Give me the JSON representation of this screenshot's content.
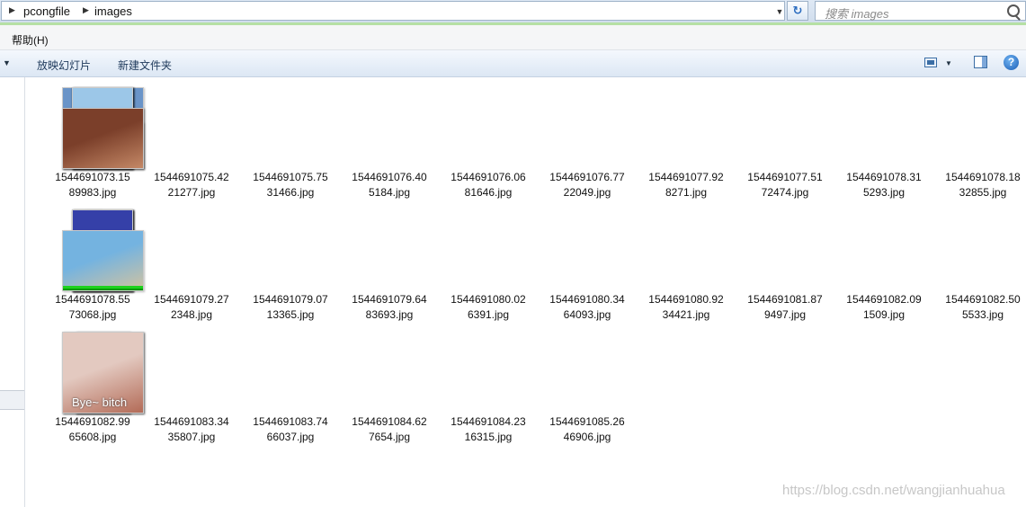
{
  "address_bar": {
    "crumbs": [
      "pcongfile",
      "images"
    ]
  },
  "search": {
    "placeholder": "搜索 images"
  },
  "menu": {
    "help": "帮助(H)"
  },
  "toolbar": {
    "slideshow": "放映幻灯片",
    "new_folder": "新建文件夹"
  },
  "files": [
    {
      "line1": "1544691073.15",
      "line2": "89983.jpg",
      "colors": [
        "#6a94c8",
        "#d6b89a"
      ]
    },
    {
      "line1": "1544691075.42",
      "line2": "21277.jpg",
      "colors": [
        "#7a6a55",
        "#c9a58c"
      ]
    },
    {
      "line1": "1544691075.75",
      "line2": "31466.jpg",
      "colors": [
        "#7c6c58",
        "#caa68d"
      ]
    },
    {
      "line1": "1544691076.40",
      "line2": "5184.jpg",
      "colors": [
        "#4b79b8",
        "#5c9a3c"
      ]
    },
    {
      "line1": "1544691076.06",
      "line2": "81646.jpg",
      "colors": [
        "#d8388a",
        "#6fa8dc"
      ]
    },
    {
      "line1": "1544691076.77",
      "line2": "22049.jpg",
      "colors": [
        "#7fb5dd",
        "#4d8fb8"
      ],
      "bars": 14
    },
    {
      "line1": "1544691077.92",
      "line2": "8271.jpg",
      "colors": [
        "#8a5a3c",
        "#c89a78"
      ]
    },
    {
      "line1": "1544691077.51",
      "line2": "72474.jpg",
      "colors": [
        "#9cc7e8",
        "#6b8c50"
      ],
      "bars": 28
    },
    {
      "line1": "1544691078.31",
      "line2": "5293.jpg",
      "colors": [
        "#3f6fae",
        "#d2a63a"
      ]
    },
    {
      "line1": "1544691078.18",
      "line2": "32855.jpg",
      "colors": [
        "#7b3f2a",
        "#c48866"
      ]
    },
    {
      "line1": "1544691078.55",
      "line2": "73068.jpg",
      "colors": [
        "#dfe7f0",
        "#b9a998"
      ],
      "bars": 18
    },
    {
      "line1": "1544691079.27",
      "line2": "2348.jpg",
      "colors": [
        "#3d5f3f",
        "#e0b59a"
      ],
      "bars": 34
    },
    {
      "line1": "1544691079.07",
      "line2": "13365.jpg",
      "colors": [
        "#6da2d6",
        "#d9b98a"
      ]
    },
    {
      "line1": "1544691079.64",
      "line2": "83693.jpg",
      "colors": [
        "#3a3a3a",
        "#c49a86"
      ]
    },
    {
      "line1": "1544691080.02",
      "line2": "6391.jpg",
      "colors": [
        "#3b67b0",
        "#9ab37b"
      ]
    },
    {
      "line1": "1544691080.34",
      "line2": "64093.jpg",
      "colors": [
        "#5d8fd0",
        "#7ea060"
      ]
    },
    {
      "line1": "1544691080.92",
      "line2": "34421.jpg",
      "colors": [
        "#f5f5f5",
        "#e8e8e8"
      ]
    },
    {
      "line1": "1544691081.87",
      "line2": "9497.jpg",
      "colors": [
        "#c9c5e8",
        "#c2a493"
      ]
    },
    {
      "line1": "1544691082.09",
      "line2": "1509.jpg",
      "colors": [
        "#3540a8",
        "#27d04a"
      ],
      "bars": 40
    },
    {
      "line1": "1544691082.50",
      "line2": "5533.jpg",
      "colors": [
        "#74b3e0",
        "#d2c3a0"
      ],
      "bars": 8
    },
    {
      "line1": "1544691082.99",
      "line2": "65608.jpg",
      "colors": [
        "#d8d0c6",
        "#a78a72"
      ]
    },
    {
      "line1": "1544691083.34",
      "line2": "35807.jpg",
      "colors": [
        "#6e7d5e",
        "#b8b3ab"
      ]
    },
    {
      "line1": "1544691083.74",
      "line2": "66037.jpg",
      "colors": [
        "#e9ece6",
        "#c5c8c2"
      ]
    },
    {
      "line1": "1544691084.62",
      "line2": "7654.jpg",
      "colors": [
        "#1d3a22",
        "#e8e8e8"
      ],
      "bars": 18
    },
    {
      "line1": "1544691084.23",
      "line2": "16315.jpg",
      "colors": [
        "#c9b590",
        "#22cc22"
      ],
      "bars": 78
    },
    {
      "line1": "1544691085.26",
      "line2": "46906.jpg",
      "colors": [
        "#e3c9c0",
        "#b36b57"
      ],
      "caption": "Bye~ bitch"
    }
  ],
  "watermark": "https://blog.csdn.net/wangjianhuahua"
}
